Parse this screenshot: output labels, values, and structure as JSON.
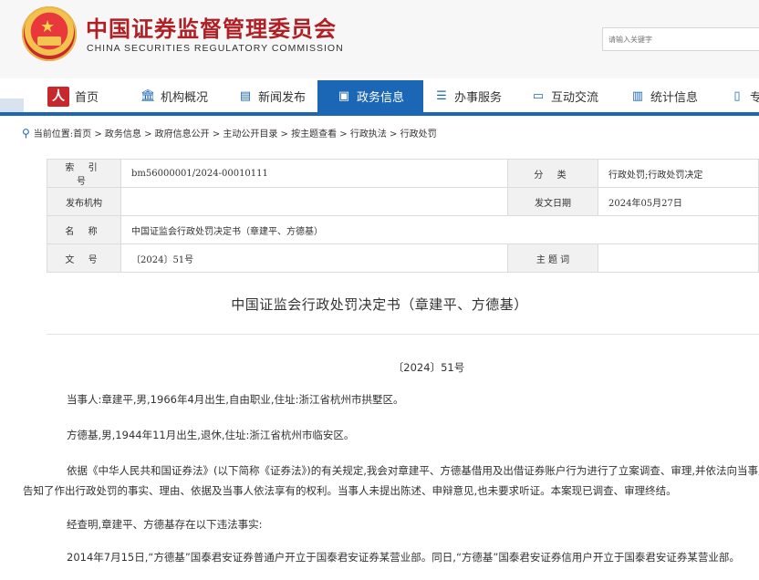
{
  "header": {
    "title": "中国证券监督管理委员会",
    "subtitle": "CHINA SECURITIES REGULATORY COMMISSION",
    "search_placeholder": "请输入关键字"
  },
  "nav": {
    "items": [
      {
        "label": "首页",
        "icon": "home-icon"
      },
      {
        "label": "机构概况",
        "icon": "building-icon"
      },
      {
        "label": "新闻发布",
        "icon": "news-icon"
      },
      {
        "label": "政务信息",
        "icon": "monitor-icon"
      },
      {
        "label": "办事服务",
        "icon": "form-icon"
      },
      {
        "label": "互动交流",
        "icon": "chat-icon"
      },
      {
        "label": "统计信息",
        "icon": "bar-chart-icon"
      },
      {
        "label": "专",
        "icon": "document-icon"
      }
    ],
    "active_index": 3,
    "accent_color": "#1c67b5"
  },
  "breadcrumb": {
    "prefix": "当前位置:",
    "path": "首页 > 政务信息 > 政府信息公开 > 主动公开目录 > 按主题查看 > 行政执法 > 行政处罚"
  },
  "info_table": {
    "index_label": "索 引 号",
    "index_value": "bm56000001/2024-00010111",
    "category_label": "分 类",
    "category_value": "行政处罚;行政处罚决定",
    "issuer_label": "发布机构",
    "issuer_value": "",
    "date_label": "发文日期",
    "date_value": "2024年05月27日",
    "name_label": "名 称",
    "name_value": "中国证监会行政处罚决定书（章建平、方德基）",
    "docno_label": "文 号",
    "docno_value": "〔2024〕51号",
    "keyword_label": "主 题 词",
    "keyword_value": ""
  },
  "document": {
    "title": "中国证监会行政处罚决定书（章建平、方德基）",
    "number": "〔2024〕51号",
    "paragraphs": [
      "当事人:章建平,男,1966年4月出生,自由职业,住址:浙江省杭州市拱墅区。",
      "方德基,男,1944年11月出生,退休,住址:浙江省杭州市临安区。",
      "依据《中华人民共和国证券法》(以下简称《证券法》)的有关规定,我会对章建平、方德基借用及出借证券账户行为进行了立案调查、审理,并依法向当事人告知了作出行政处罚的事实、理由、依据及当事人依法享有的权利。当事人未提出陈述、申辩意见,也未要求听证。本案现已调查、审理终结。",
      "经查明,章建平、方德基存在以下违法事实:",
      "2014年7月15日,“方德基”国泰君安证券普通户开立于国泰君安证券某营业部。同日,“方德基”国泰君安证券信用户开立于国泰君安证券某营业部。"
    ]
  }
}
